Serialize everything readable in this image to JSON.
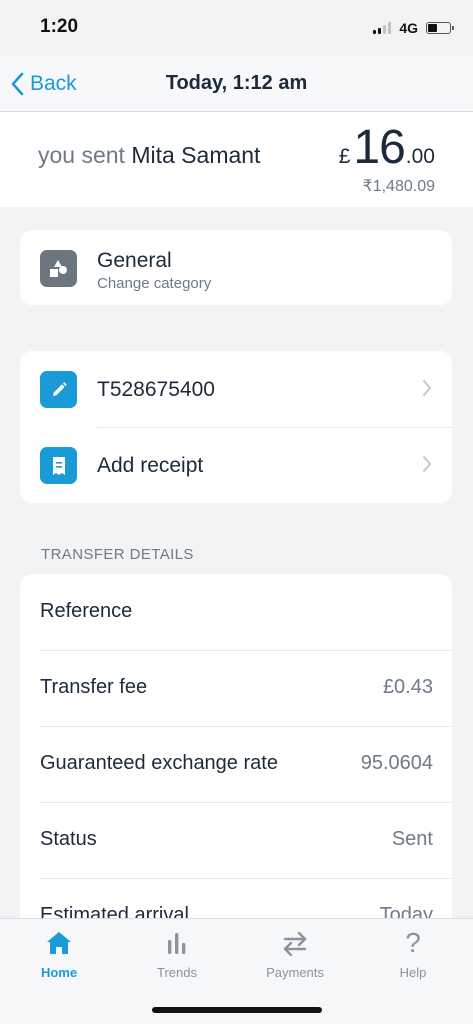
{
  "status_bar": {
    "time": "1:20",
    "network": "4G",
    "battery_level": 0.45,
    "signal_bars_active": 2,
    "signal_bars_total": 4
  },
  "nav": {
    "back_label": "Back",
    "title": "Today, 1:12 am"
  },
  "summary": {
    "prefix": "you sent ",
    "recipient": "Mita Samant",
    "currency_symbol": "£",
    "amount_major": "16",
    "amount_minor": ".00",
    "converted_amount": "₹1,480.09"
  },
  "category": {
    "title": "General",
    "subtitle": "Change category",
    "icon": "shapes-icon"
  },
  "actions": [
    {
      "label": "T528675400",
      "icon": "pencil-icon"
    },
    {
      "label": "Add receipt",
      "icon": "receipt-icon"
    }
  ],
  "transfer_details": {
    "header": "TRANSFER DETAILS",
    "rows": [
      {
        "label": "Reference",
        "value": ""
      },
      {
        "label": "Transfer fee",
        "value": "£0.43"
      },
      {
        "label": "Guaranteed exchange rate",
        "value": "95.0604"
      },
      {
        "label": "Status",
        "value": "Sent"
      },
      {
        "label": "Estimated arrival",
        "value": "Today"
      }
    ]
  },
  "tabs": [
    {
      "label": "Home",
      "icon": "home-icon",
      "active": true
    },
    {
      "label": "Trends",
      "icon": "bar-chart-icon",
      "active": false
    },
    {
      "label": "Payments",
      "icon": "transfer-arrows-icon",
      "active": false
    },
    {
      "label": "Help",
      "icon": "question-icon",
      "active": false
    }
  ],
  "colors": {
    "accent": "#1a9bd8",
    "text_primary": "#1c2a3a",
    "text_secondary": "#6e7a87",
    "background": "#f2f3f5",
    "icon_grey": "#6c7680"
  }
}
